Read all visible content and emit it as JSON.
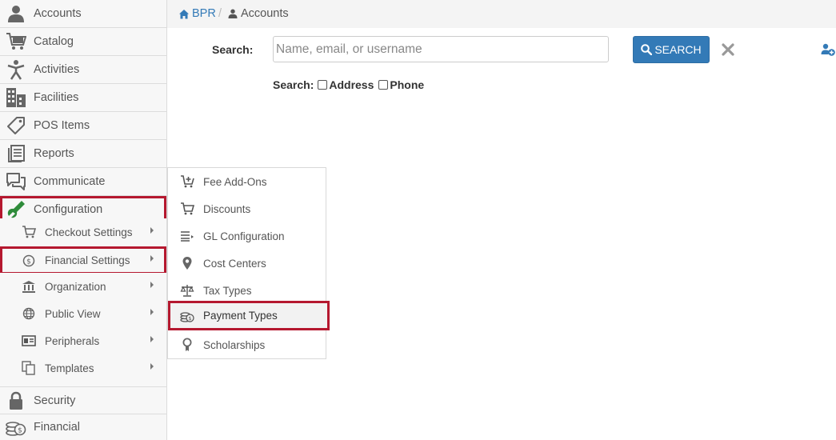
{
  "breadcrumb": {
    "home": "BPR",
    "separator": "/",
    "current": "Accounts"
  },
  "sidebar": {
    "items": [
      {
        "label": "Accounts",
        "icon": "person-icon"
      },
      {
        "label": "Catalog",
        "icon": "cart-icon"
      },
      {
        "label": "Activities",
        "icon": "activity-person-icon"
      },
      {
        "label": "Facilities",
        "icon": "building-icon"
      },
      {
        "label": "POS Items",
        "icon": "tag-icon"
      },
      {
        "label": "Reports",
        "icon": "reports-icon"
      },
      {
        "label": "Communicate",
        "icon": "chat-icon"
      },
      {
        "label": "Configuration",
        "icon": "wrench-icon",
        "accent": "#2e8b3a"
      },
      {
        "label": "Security",
        "icon": "lock-icon"
      },
      {
        "label": "Financial",
        "icon": "coins-icon"
      }
    ],
    "config_children": [
      {
        "label": "Checkout Settings",
        "icon": "cart-icon"
      },
      {
        "label": "Financial Settings",
        "icon": "dollar-circle-icon"
      },
      {
        "label": "Organization",
        "icon": "bank-icon"
      },
      {
        "label": "Public View",
        "icon": "globe-icon"
      },
      {
        "label": "Peripherals",
        "icon": "id-card-icon"
      },
      {
        "label": "Templates",
        "icon": "copy-icon"
      }
    ]
  },
  "search": {
    "label": "Search:",
    "placeholder": "Name, email, or username",
    "value": "",
    "button_label": "SEARCH",
    "options_label": "Search:",
    "option_address": "Address",
    "option_phone": "Phone"
  },
  "flyout": {
    "items": [
      {
        "label": "Fee Add-Ons",
        "icon": "cart-plus-icon"
      },
      {
        "label": "Discounts",
        "icon": "cart-icon"
      },
      {
        "label": "GL Configuration",
        "icon": "list-icon"
      },
      {
        "label": "Cost Centers",
        "icon": "map-pin-icon"
      },
      {
        "label": "Tax Types",
        "icon": "scale-icon"
      },
      {
        "label": "Payment Types",
        "icon": "coins-icon"
      },
      {
        "label": "Scholarships",
        "icon": "award-icon"
      }
    ]
  },
  "colors": {
    "accent": "#337ab7",
    "highlight": "#b5182f",
    "configuration_icon": "#2e8b3a"
  }
}
